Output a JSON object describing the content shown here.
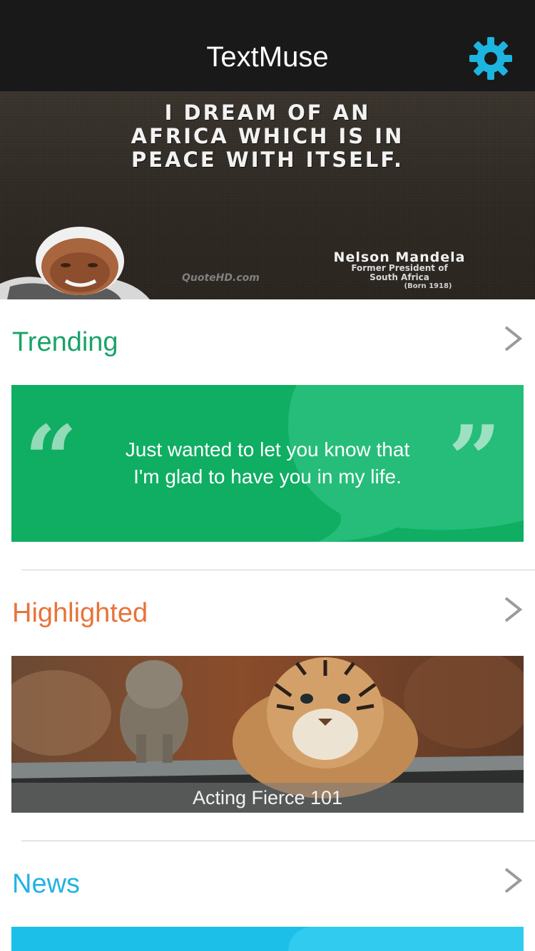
{
  "header": {
    "title": "TextMuse",
    "settings_icon": "gear-icon",
    "accent_color": "#1cb5e0"
  },
  "hero": {
    "quote_lines": [
      "I DREAM OF AN",
      "AFRICA WHICH IS IN",
      "PEACE WITH ITSELF."
    ],
    "author": "Nelson Mandela",
    "role_line1": "Former President of",
    "role_line2": "South Africa",
    "born": "(Born 1918)",
    "watermark": "QuoteHD.com"
  },
  "sections": {
    "trending": {
      "title": "Trending",
      "color": "#1aa36a",
      "card": {
        "message_line1": "Just wanted to let you know that",
        "message_line2": "I'm glad to have you in my life.",
        "open_quote": "“",
        "close_quote": "”",
        "color": "#0fae62"
      }
    },
    "highlighted": {
      "title": "Highlighted",
      "color": "#e8733a",
      "card": {
        "caption": "Acting Fierce 101"
      }
    },
    "news": {
      "title": "News",
      "color": "#22b3e3"
    }
  },
  "icons": {
    "chevron": "chevron-right-icon"
  }
}
